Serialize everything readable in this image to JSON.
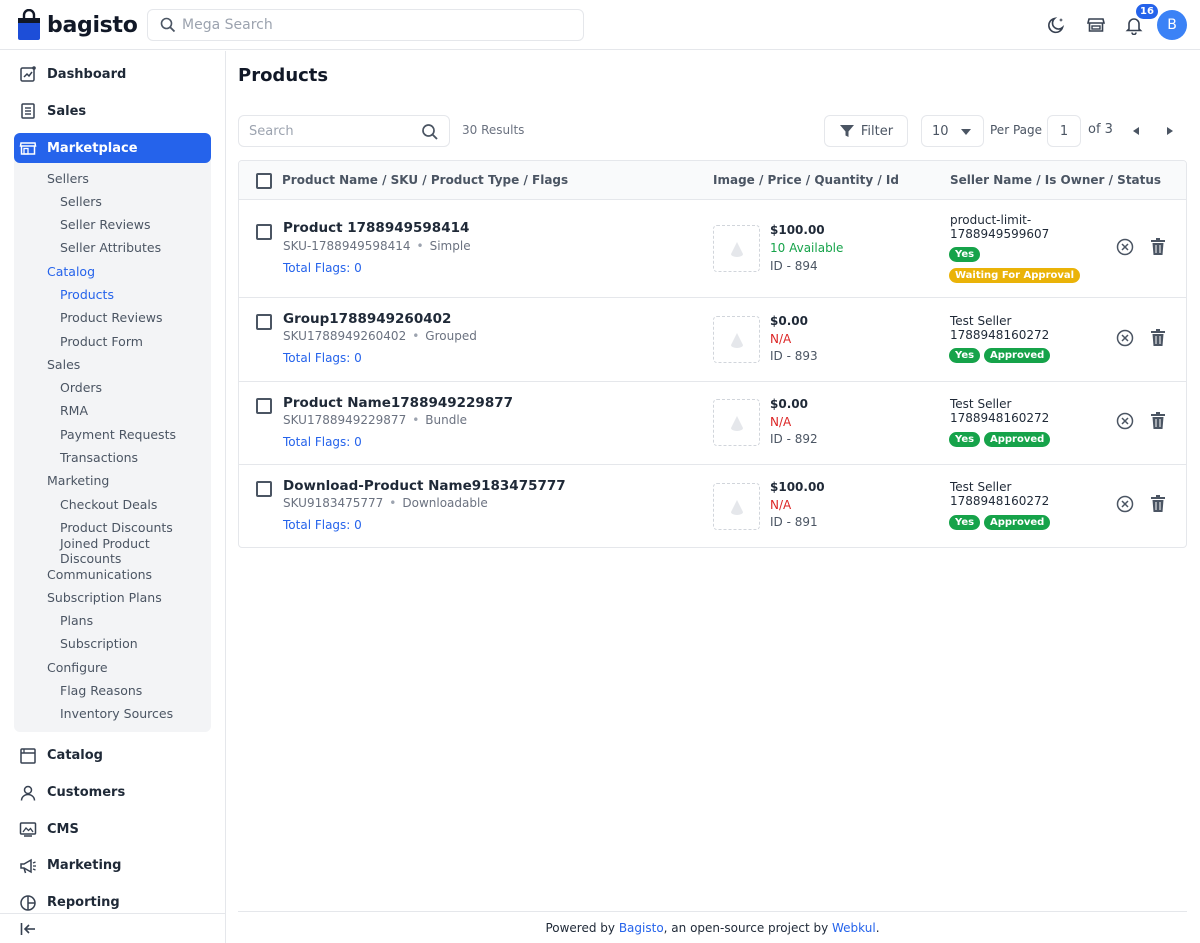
{
  "header": {
    "logo_text": "bagisto",
    "search_placeholder": "Mega Search",
    "notification_count": "16",
    "avatar_initial": "B",
    "icons": [
      "dark-mode-icon",
      "store-icon",
      "bell-icon"
    ]
  },
  "sidebar": {
    "top_items": [
      {
        "label": "Dashboard",
        "icon": "dashboard-icon"
      },
      {
        "label": "Sales",
        "icon": "sales-icon"
      }
    ],
    "active_item": {
      "label": "Marketplace",
      "icon": "marketplace-icon"
    },
    "marketplace_sub": [
      {
        "label": "Sellers",
        "level": 1
      },
      {
        "label": "Sellers",
        "level": 2
      },
      {
        "label": "Seller Reviews",
        "level": 2
      },
      {
        "label": "Seller Attributes",
        "level": 2
      },
      {
        "label": "Catalog",
        "level": 1,
        "active": true
      },
      {
        "label": "Products",
        "level": 2,
        "active": true
      },
      {
        "label": "Product Reviews",
        "level": 2
      },
      {
        "label": "Product Form",
        "level": 2
      },
      {
        "label": "Sales",
        "level": 1
      },
      {
        "label": "Orders",
        "level": 2
      },
      {
        "label": "RMA",
        "level": 2
      },
      {
        "label": "Payment Requests",
        "level": 2
      },
      {
        "label": "Transactions",
        "level": 2
      },
      {
        "label": "Marketing",
        "level": 1
      },
      {
        "label": "Checkout Deals",
        "level": 2
      },
      {
        "label": "Product Discounts",
        "level": 2
      },
      {
        "label": "Joined Product Discounts",
        "level": 2
      },
      {
        "label": "Communications",
        "level": 1
      },
      {
        "label": "Subscription Plans",
        "level": 1
      },
      {
        "label": "Plans",
        "level": 2
      },
      {
        "label": "Subscription",
        "level": 2
      },
      {
        "label": "Configure",
        "level": 1
      },
      {
        "label": "Flag Reasons",
        "level": 2
      },
      {
        "label": "Inventory Sources",
        "level": 2
      }
    ],
    "bottom_items": [
      {
        "label": "Catalog",
        "icon": "catalog-icon"
      },
      {
        "label": "Customers",
        "icon": "customers-icon"
      },
      {
        "label": "CMS",
        "icon": "cms-icon"
      },
      {
        "label": "Marketing",
        "icon": "marketing-icon"
      },
      {
        "label": "Reporting",
        "icon": "reporting-icon"
      }
    ]
  },
  "main": {
    "title": "Products",
    "search_placeholder": "Search",
    "results_text": "30 Results",
    "filter_label": "Filter",
    "per_page_value": "10",
    "per_page_label": "Per Page",
    "current_page": "1",
    "of_pages": "of 3"
  },
  "table": {
    "headers": [
      "Product Name / SKU / Product Type / Flags",
      "Image / Price / Quantity / Id",
      "Seller Name / Is Owner / Status"
    ],
    "rows": [
      {
        "name": "Product 1788949598414",
        "sku": "SKU-1788949598414",
        "type": "Simple",
        "flags": "Total Flags: 0",
        "price": "$100.00",
        "quantity": "10 Available",
        "quantity_status": "green",
        "id": "ID - 894",
        "seller": "product-limit-1788949599607",
        "owner": "Yes",
        "status": "Waiting For Approval",
        "status_color": "yellow"
      },
      {
        "name": "Group1788949260402",
        "sku": "SKU1788949260402",
        "type": "Grouped",
        "flags": "Total Flags: 0",
        "price": "$0.00",
        "quantity": "N/A",
        "quantity_status": "red",
        "id": "ID - 893",
        "seller": "Test Seller 1788948160272",
        "owner": "Yes",
        "status": "Approved",
        "status_color": "green"
      },
      {
        "name": "Product Name1788949229877",
        "sku": "SKU1788949229877",
        "type": "Bundle",
        "flags": "Total Flags: 0",
        "price": "$0.00",
        "quantity": "N/A",
        "quantity_status": "red",
        "id": "ID - 892",
        "seller": "Test Seller 1788948160272",
        "owner": "Yes",
        "status": "Approved",
        "status_color": "green"
      },
      {
        "name": "Download-Product Name9183475777",
        "sku": "SKU9183475777",
        "type": "Downloadable",
        "flags": "Total Flags: 0",
        "price": "$100.00",
        "quantity": "N/A",
        "quantity_status": "red",
        "id": "ID - 891",
        "seller": "Test Seller 1788948160272",
        "owner": "Yes",
        "status": "Approved",
        "status_color": "green"
      }
    ]
  },
  "footer": {
    "prefix": "Powered by ",
    "link1": "Bagisto",
    "middle": ", an open-source project by ",
    "link2": "Webkul",
    "suffix": "."
  },
  "colors": {
    "accent": "#2563eb",
    "success": "#16a34a",
    "warning": "#eab308",
    "danger": "#dc2626"
  }
}
